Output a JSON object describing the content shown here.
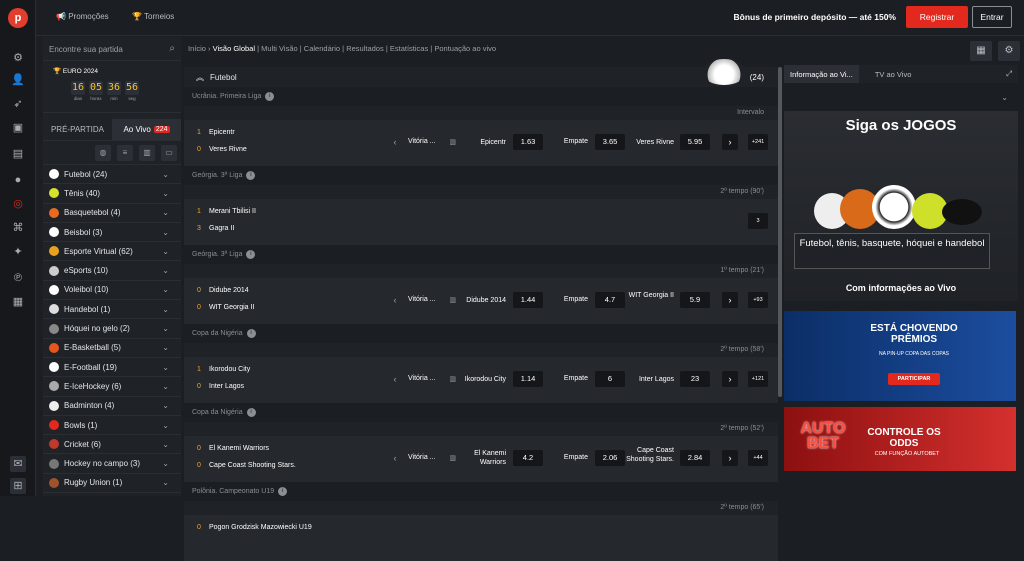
{
  "nav": {
    "promos": "Promoções",
    "tourneys": "Torneios",
    "bonus": "Bônus de primeiro depósito — até 150%",
    "register": "Registrar",
    "login": "Entrar"
  },
  "sidebar": {
    "search_placeholder": "Encontre sua partida",
    "euro_title": "EURO 2024",
    "countdown": [
      {
        "v": "16",
        "l": "dias"
      },
      {
        "v": "05",
        "l": "horas"
      },
      {
        "v": "36",
        "l": "min"
      },
      {
        "v": "56",
        "l": "seg"
      }
    ],
    "tab_pre": "PRÉ-PARTIDA",
    "tab_live": "Ao Vivo",
    "live_count": "224",
    "sports": [
      {
        "label": "Futebol (24)",
        "color": "#ffffff"
      },
      {
        "label": "Tênis (40)",
        "color": "#d7e22a"
      },
      {
        "label": "Basquetebol (4)",
        "color": "#e86a1f"
      },
      {
        "label": "Beisbol (3)",
        "color": "#ffffff"
      },
      {
        "label": "Esporte Virtual (62)",
        "color": "#e8a11f"
      },
      {
        "label": "eSports (10)",
        "color": "#cccccc"
      },
      {
        "label": "Voleibol (10)",
        "color": "#ffffff"
      },
      {
        "label": "Handebol (1)",
        "color": "#dddddd"
      },
      {
        "label": "Hóquei no gelo (2)",
        "color": "#888888"
      },
      {
        "label": "E-Basketball (5)",
        "color": "#e8561f"
      },
      {
        "label": "E-Football (19)",
        "color": "#ffffff"
      },
      {
        "label": "E-IceHockey (6)",
        "color": "#aaaaaa"
      },
      {
        "label": "Badminton (4)",
        "color": "#eeeeee"
      },
      {
        "label": "Bowls (1)",
        "color": "#e3281e"
      },
      {
        "label": "Cricket (6)",
        "color": "#c0392b"
      },
      {
        "label": "Hockey no campo (3)",
        "color": "#777777"
      },
      {
        "label": "Rugby Union (1)",
        "color": "#a0522d"
      }
    ]
  },
  "breadcrumb": [
    "Início",
    "Visão Global",
    "Multi Visão",
    "Calendário",
    "Resultados",
    "Estatísticas",
    "Pontuação ao vivo"
  ],
  "section": {
    "title": "Futebol",
    "count": "(24)"
  },
  "matches": [
    {
      "league": "Ucrânia. Primeira Liga",
      "status": "Intervalo",
      "home": "Epicentr",
      "away": "Veres Rivne",
      "hs": "1",
      "as": "0",
      "l1": "Vitória ...",
      "l2": "Epicentr",
      "o1": "1.63",
      "ld": "Empate",
      "od": "3.65",
      "l3": "Veres Rivne",
      "o2": "5.95",
      "more": "+241"
    },
    {
      "league": "Geórgia. 3ª Liga",
      "status": "2º tempo  (90')",
      "home": "Merani Tbilisi II",
      "away": "Gagra II",
      "hs": "1",
      "as": "3",
      "more": "3"
    },
    {
      "league": "Geórgia. 3ª Liga",
      "status": "1º tempo  (21')",
      "home": "Didube 2014",
      "away": "WIT Georgia II",
      "hs": "0",
      "as": "0",
      "l1": "Vitória ...",
      "l2": "Didube 2014",
      "o1": "1.44",
      "ld": "Empate",
      "od": "4.7",
      "l3": "WIT Georgia II",
      "o2": "5.9",
      "more": "+93"
    },
    {
      "league": "Copa da Nigéria",
      "status": "2º tempo  (58')",
      "home": "Ikorodou City",
      "away": "Inter Lagos",
      "hs": "1",
      "as": "0",
      "l1": "Vitória ...",
      "l2": "Ikorodou City",
      "o1": "1.14",
      "ld": "Empate",
      "od": "6",
      "l3": "Inter Lagos",
      "o2": "23",
      "more": "+121"
    },
    {
      "league": "Copa da Nigéria",
      "status": "2º tempo  (52')",
      "home": "El Kanemi Warriors",
      "away": "Cape Coast Shooting Stars.",
      "hs": "0",
      "as": "0",
      "l1": "Vitória ...",
      "l2": "El Kanemi Warriors",
      "o1": "4.2",
      "ld": "Empate",
      "od": "2.06",
      "l3": "Cape Coast Shooting Stars.",
      "o2": "2.84",
      "more": "+44"
    },
    {
      "league": "Polônia. Campeonato U19",
      "status": "2º tempo  (65')",
      "home": "Pogon Grodzisk Mazowiecki U19",
      "away": "",
      "hs": "0",
      "as": ""
    }
  ],
  "right": {
    "tab1": "Informação ao Vi...",
    "tab2": "TV ao Vivo",
    "promo_title": "Siga os JOGOS",
    "promo_text": "Futebol, tênis, basquete, hóquei e handebol",
    "promo_sub": "Com informações ao Vivo",
    "banner1": {
      "title": "ESTÁ CHOVENDO PRÊMIOS",
      "sub": "NA PIN-UP COPA DAS COPAS",
      "cta": "PARTICIPAR"
    },
    "banner2": {
      "logo": "AUTO BET",
      "title": "CONTROLE OS ODDS",
      "sub": "COM FUNÇÃO AUTOBET"
    }
  }
}
